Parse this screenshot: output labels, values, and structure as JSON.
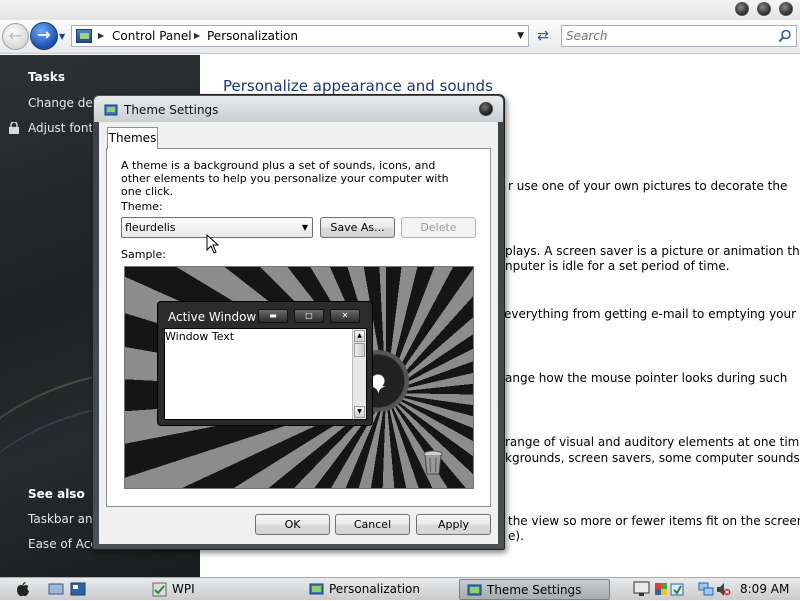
{
  "window": {
    "breadcrumb": [
      "Control Panel",
      "Personalization"
    ],
    "search_placeholder": "Search"
  },
  "taskpane": {
    "tasks_heading": "Tasks",
    "task_links": [
      "Change desi",
      "Adjust font s"
    ],
    "see_also_heading": "See also",
    "see_also_links": [
      "Taskbar and",
      "Ease of Acce"
    ]
  },
  "content": {
    "title": "Personalize appearance and sounds",
    "lines": [
      "r use one of your own pictures to decorate the",
      "plays. A screen saver is a picture or animation that",
      "nputer is idle for a set period of time.",
      "everything from getting e-mail to emptying your",
      "ange how the mouse pointer looks during such",
      "range of visual and auditory elements at one time",
      "kgrounds, screen savers, some computer sounds, and",
      "the view so more or fewer items fit on the screen.",
      "e)."
    ]
  },
  "dialog": {
    "title": "Theme Settings",
    "tab": "Themes",
    "description": "A theme is a background plus a set of sounds, icons, and other elements to help you personalize your computer with one click.",
    "theme_label": "Theme:",
    "theme_value": "fleurdelis",
    "save_as": "Save As...",
    "delete": "Delete",
    "sample_label": "Sample:",
    "sample_window_title": "Active Window",
    "sample_window_text": "Window Text",
    "ok": "OK",
    "cancel": "Cancel",
    "apply": "Apply"
  },
  "taskbar": {
    "items": [
      "WPI",
      "Personalization",
      "Theme Settings"
    ],
    "active_item": "Theme Settings",
    "clock": "8:09 AM"
  },
  "colors": {
    "title_blue": "#1e3287",
    "taskpane_dark": "#1e2224"
  }
}
